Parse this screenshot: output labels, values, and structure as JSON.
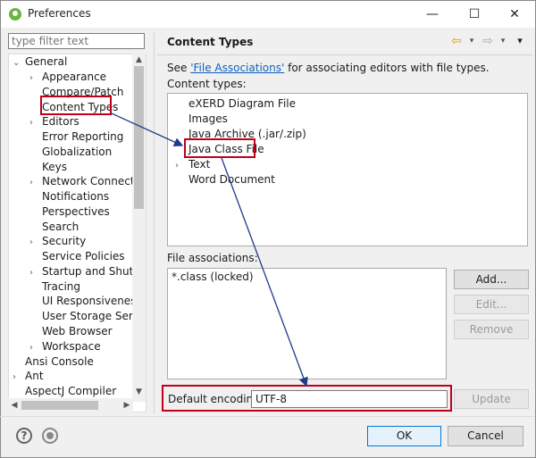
{
  "window": {
    "title": "Preferences",
    "minimize": "—",
    "maximize": "☐",
    "close": "✕"
  },
  "filter": {
    "placeholder": "type filter text"
  },
  "tree": [
    {
      "label": "General",
      "twisty": "⌄"
    },
    {
      "label": "Appearance",
      "twisty": "›"
    },
    {
      "label": "Compare/Patch",
      "twisty": ""
    },
    {
      "label": "Content Types",
      "twisty": ""
    },
    {
      "label": "Editors",
      "twisty": "›"
    },
    {
      "label": "Error Reporting",
      "twisty": ""
    },
    {
      "label": "Globalization",
      "twisty": ""
    },
    {
      "label": "Keys",
      "twisty": ""
    },
    {
      "label": "Network Connection",
      "twisty": "›"
    },
    {
      "label": "Notifications",
      "twisty": ""
    },
    {
      "label": "Perspectives",
      "twisty": ""
    },
    {
      "label": "Search",
      "twisty": ""
    },
    {
      "label": "Security",
      "twisty": "›"
    },
    {
      "label": "Service Policies",
      "twisty": ""
    },
    {
      "label": "Startup and Shutdo",
      "twisty": "›"
    },
    {
      "label": "Tracing",
      "twisty": ""
    },
    {
      "label": "UI Responsiveness M",
      "twisty": ""
    },
    {
      "label": "User Storage Servic",
      "twisty": ""
    },
    {
      "label": "Web Browser",
      "twisty": ""
    },
    {
      "label": "Workspace",
      "twisty": "›"
    },
    {
      "label": "Ansi Console",
      "twisty": ""
    },
    {
      "label": "Ant",
      "twisty": "›"
    },
    {
      "label": "AspectJ Compiler",
      "twisty": ""
    }
  ],
  "page": {
    "title": "Content Types",
    "see_prefix": "See ",
    "see_link": "'File Associations'",
    "see_suffix": " for associating editors with file types.",
    "content_types_label": "Content types:",
    "content_types": [
      {
        "label": "eXERD Diagram File",
        "twisty": ""
      },
      {
        "label": "Images",
        "twisty": ""
      },
      {
        "label": "Java Archive (.jar/.zip)",
        "twisty": ""
      },
      {
        "label": "Java Class File",
        "twisty": ""
      },
      {
        "label": "Text",
        "twisty": "›"
      },
      {
        "label": "Word Document",
        "twisty": ""
      }
    ],
    "file_assoc_label": "File associations:",
    "file_associations": [
      "*.class (locked)"
    ],
    "add_button": "Add...",
    "edit_button": "Edit...",
    "remove_button": "Remove",
    "encoding_label": "Default encoding:",
    "encoding_value": "UTF-8",
    "update_button": "Update"
  },
  "nav": {
    "back": "⇦",
    "forward": "⇨",
    "dropdown": "▾",
    "menu": "▾"
  },
  "footer": {
    "ok": "OK",
    "cancel": "Cancel",
    "help": "?"
  },
  "colors": {
    "highlight": "#c0001a",
    "arrow": "#1e3a8a",
    "link": "#1060c0"
  }
}
